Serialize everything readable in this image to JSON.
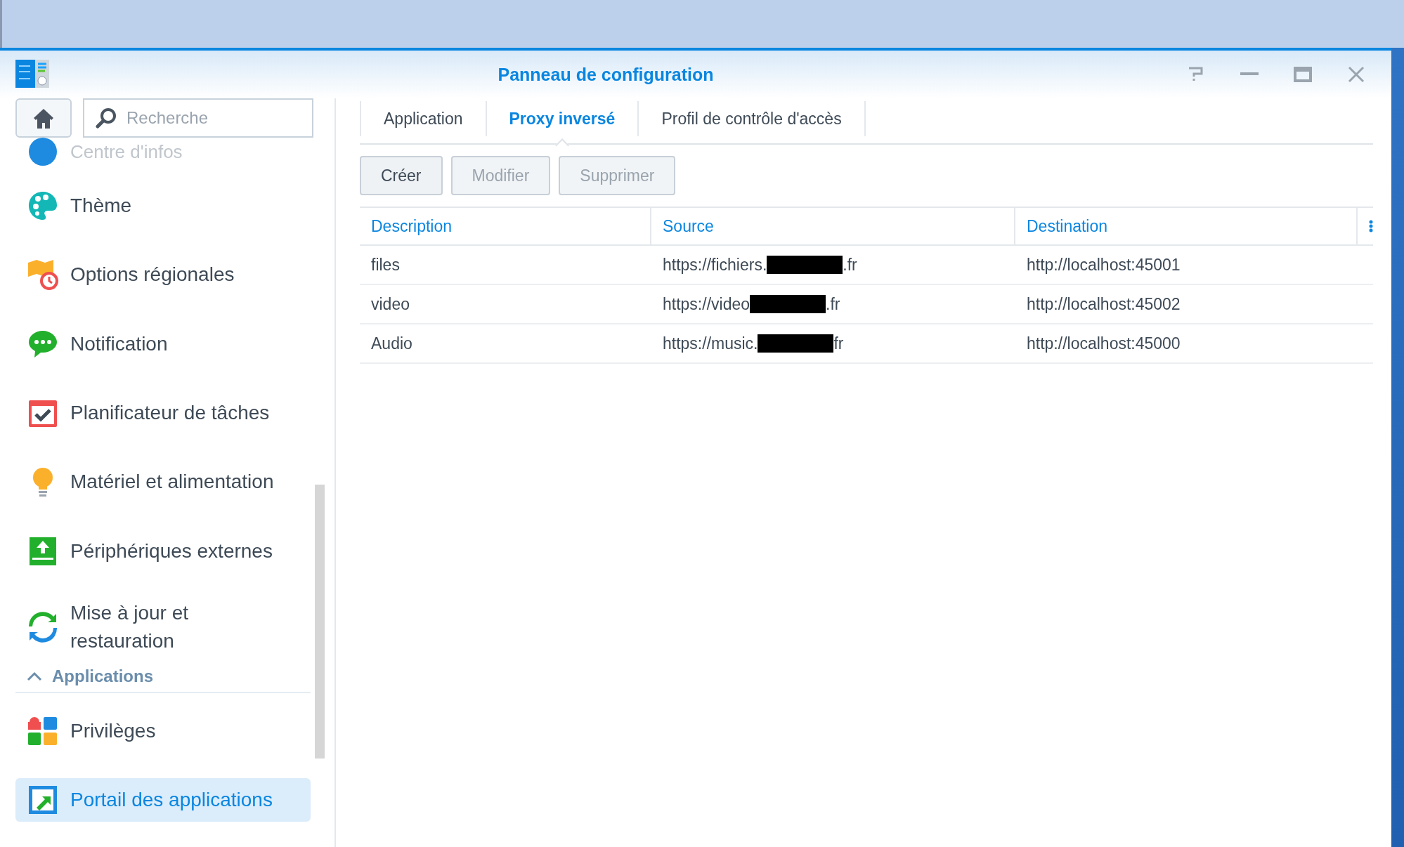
{
  "window": {
    "title": "Panneau de configuration"
  },
  "search": {
    "placeholder": "Recherche"
  },
  "sidebar": {
    "items": [
      {
        "kind": "faded",
        "label": "Centre d'infos"
      },
      {
        "kind": "item",
        "label": "Thème",
        "selected": false
      },
      {
        "kind": "item",
        "label": "Options régionales",
        "selected": false
      },
      {
        "kind": "item",
        "label": "Notification",
        "selected": false
      },
      {
        "kind": "item",
        "label": "Planificateur de tâches",
        "selected": false
      },
      {
        "kind": "item",
        "label": "Matériel et alimentation",
        "selected": false
      },
      {
        "kind": "item",
        "label": "Périphériques externes",
        "selected": false
      },
      {
        "kind": "item",
        "label": "Mise à jour et restauration",
        "selected": false
      },
      {
        "kind": "section",
        "label": "Applications",
        "expanded": true
      },
      {
        "kind": "item",
        "label": "Privilèges",
        "selected": false
      },
      {
        "kind": "item",
        "label": "Portail des applications",
        "selected": true
      }
    ]
  },
  "tabs": [
    {
      "label": "Application",
      "selected": false
    },
    {
      "label": "Proxy inversé",
      "selected": true
    },
    {
      "label": "Profil de contrôle d'accès",
      "selected": false
    }
  ],
  "buttons": [
    {
      "label": "Créer",
      "disabled": false
    },
    {
      "label": "Modifier",
      "disabled": true
    },
    {
      "label": "Supprimer",
      "disabled": true
    }
  ],
  "table": {
    "columns": [
      "Description",
      "Source",
      "Destination"
    ],
    "rows": [
      {
        "description": "files",
        "source_start": "https://fichiers.",
        "source_end": ".fr",
        "destination": "http://localhost:45001"
      },
      {
        "description": "video",
        "source_start": "https://video",
        "source_end": ".fr",
        "destination": "http://localhost:45002"
      },
      {
        "description": "Audio",
        "source_start": "https://music.",
        "source_end": "fr",
        "destination": "http://localhost:45000"
      }
    ]
  }
}
